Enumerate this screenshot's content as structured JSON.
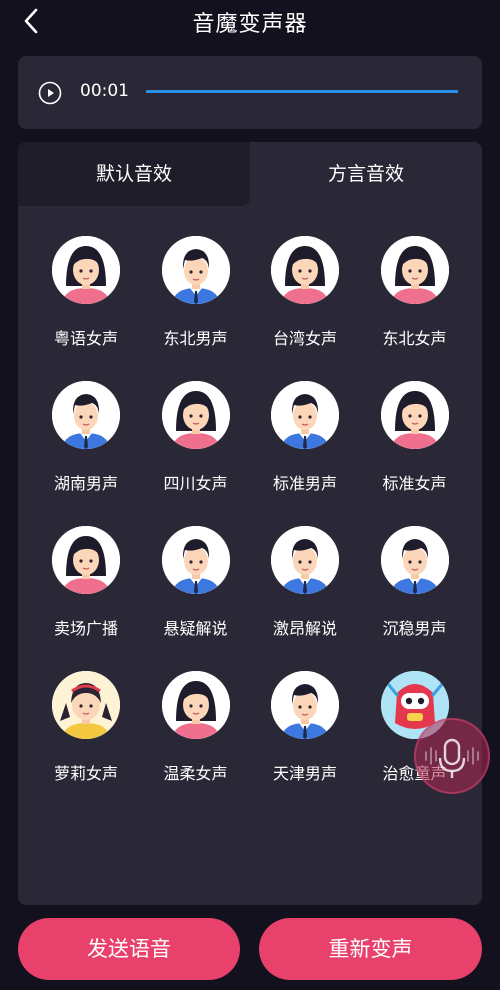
{
  "header": {
    "title": "音魔变声器",
    "back_icon": "chevron-left-icon"
  },
  "player": {
    "time": "00:01",
    "progress": 1.0,
    "play_icon": "play-icon",
    "accent": "#2d8ee8"
  },
  "tabs": [
    {
      "label": "默认音效",
      "selected": true
    },
    {
      "label": "方言音效",
      "selected": false
    }
  ],
  "voices": [
    {
      "label": "粤语女声",
      "avatar": "woman"
    },
    {
      "label": "东北男声",
      "avatar": "man"
    },
    {
      "label": "台湾女声",
      "avatar": "woman"
    },
    {
      "label": "东北女声",
      "avatar": "woman"
    },
    {
      "label": "湖南男声",
      "avatar": "man"
    },
    {
      "label": "四川女声",
      "avatar": "woman"
    },
    {
      "label": "标准男声",
      "avatar": "man"
    },
    {
      "label": "标准女声",
      "avatar": "woman"
    },
    {
      "label": "卖场广播",
      "avatar": "woman"
    },
    {
      "label": "悬疑解说",
      "avatar": "man"
    },
    {
      "label": "激昂解说",
      "avatar": "man"
    },
    {
      "label": "沉稳男声",
      "avatar": "man"
    },
    {
      "label": "萝莉女声",
      "avatar": "girl"
    },
    {
      "label": "温柔女声",
      "avatar": "woman"
    },
    {
      "label": "天津男声",
      "avatar": "man"
    },
    {
      "label": "治愈童声",
      "avatar": "robot"
    }
  ],
  "floating_button": {
    "icon": "microphone-icon"
  },
  "actions": {
    "send": "发送语音",
    "redo": "重新变声"
  },
  "colors": {
    "background": "#14111f",
    "card": "#2a2836",
    "button": "#e8416c"
  }
}
